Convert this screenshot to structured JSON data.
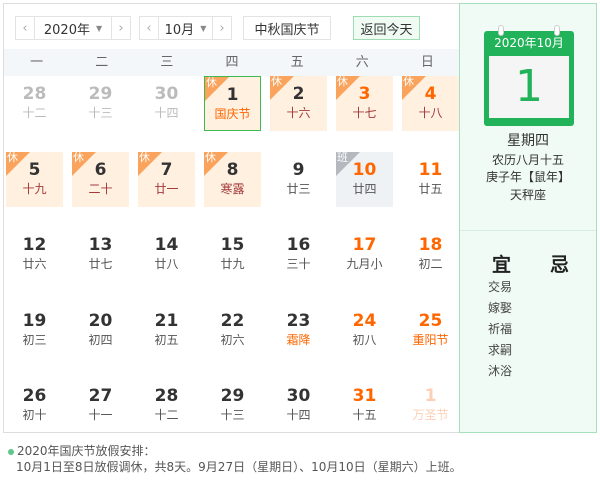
{
  "controls": {
    "year": "2020年",
    "month": "10月",
    "holiday": "中秋国庆节",
    "today_btn": "返回今天",
    "prev": "‹",
    "next": "›",
    "caret": "▼"
  },
  "weekdays": [
    "一",
    "二",
    "三",
    "四",
    "五",
    "六",
    "日"
  ],
  "cells": [
    {
      "d": "28",
      "l": "十二",
      "t": "other"
    },
    {
      "d": "29",
      "l": "十三",
      "t": "other"
    },
    {
      "d": "30",
      "l": "十四",
      "t": "other"
    },
    {
      "d": "1",
      "l": "国庆节",
      "t": "rest",
      "today": true,
      "fest": true
    },
    {
      "d": "2",
      "l": "十六",
      "t": "rest"
    },
    {
      "d": "3",
      "l": "十七",
      "t": "rest",
      "we": true
    },
    {
      "d": "4",
      "l": "十八",
      "t": "rest",
      "we": true
    },
    {
      "d": "5",
      "l": "十九",
      "t": "rest"
    },
    {
      "d": "6",
      "l": "二十",
      "t": "rest"
    },
    {
      "d": "7",
      "l": "廿一",
      "t": "rest"
    },
    {
      "d": "8",
      "l": "寒露",
      "t": "rest"
    },
    {
      "d": "9",
      "l": "廿三"
    },
    {
      "d": "10",
      "l": "廿四",
      "t": "work",
      "we": true
    },
    {
      "d": "11",
      "l": "廿五",
      "we": true
    },
    {
      "d": "12",
      "l": "廿六"
    },
    {
      "d": "13",
      "l": "廿七"
    },
    {
      "d": "14",
      "l": "廿八"
    },
    {
      "d": "15",
      "l": "廿九"
    },
    {
      "d": "16",
      "l": "三十"
    },
    {
      "d": "17",
      "l": "九月小",
      "we": true
    },
    {
      "d": "18",
      "l": "初二",
      "we": true
    },
    {
      "d": "19",
      "l": "初三"
    },
    {
      "d": "20",
      "l": "初四"
    },
    {
      "d": "21",
      "l": "初五"
    },
    {
      "d": "22",
      "l": "初六"
    },
    {
      "d": "23",
      "l": "霜降",
      "fest": true
    },
    {
      "d": "24",
      "l": "初八",
      "we": true
    },
    {
      "d": "25",
      "l": "重阳节",
      "we": true,
      "fest": true
    },
    {
      "d": "26",
      "l": "初十"
    },
    {
      "d": "27",
      "l": "十一"
    },
    {
      "d": "28",
      "l": "十二"
    },
    {
      "d": "29",
      "l": "十三"
    },
    {
      "d": "30",
      "l": "十四"
    },
    {
      "d": "31",
      "l": "十五",
      "we": true
    },
    {
      "d": "1",
      "l": "万圣节",
      "t": "next"
    }
  ],
  "badges": {
    "rest": "休",
    "work": "班"
  },
  "detail": {
    "ym": "2020年10月",
    "day": "1",
    "weekday": "星期四",
    "lunar": "农历八月十五",
    "ganzhi": "庚子年【鼠年】",
    "star": "天秤座",
    "yi": "宜",
    "ji": "忌",
    "yi_items": [
      "交易",
      "嫁娶",
      "祈福",
      "求嗣",
      "沐浴"
    ]
  },
  "note": {
    "title": "2020年国庆节放假安排：",
    "body": "10月1日至8日放假调休，共8天。9月27日（星期日）、10月10日（星期六）上班。"
  },
  "colors": {
    "accent": "#22b35a",
    "weekend": "#ff6600",
    "rest_lunar": "#a33a3a"
  }
}
